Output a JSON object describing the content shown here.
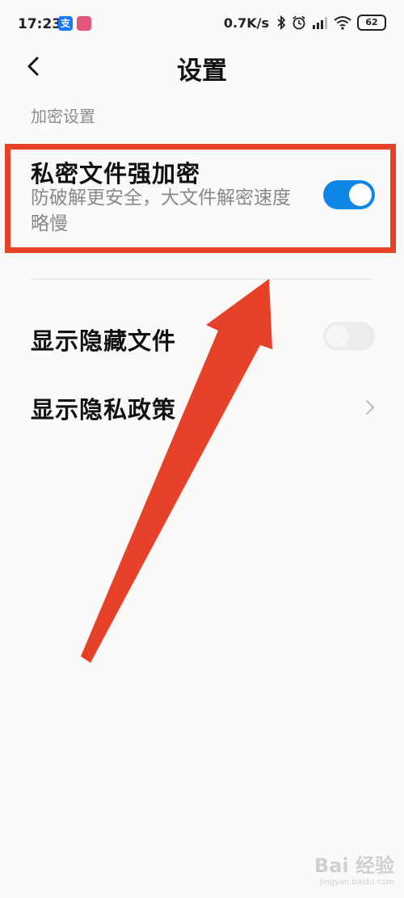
{
  "status_bar": {
    "time": "17:23",
    "network_speed": "0.7K/s",
    "battery_level": "62",
    "app_icon_1_label": "支",
    "icons": [
      "alipay-icon",
      "pink-app-icon",
      "bluetooth-icon",
      "alarm-icon",
      "signal-icon",
      "wifi-icon",
      "battery-icon"
    ]
  },
  "header": {
    "title": "设置",
    "back_icon": "chevron-left-icon"
  },
  "section": {
    "title": "加密设置"
  },
  "settings": {
    "encryption": {
      "title": "私密文件强加密",
      "description": "防破解更安全，大文件解密速度略慢",
      "enabled": true
    },
    "show_hidden": {
      "title": "显示隐藏文件",
      "enabled": false
    },
    "privacy_policy": {
      "title": "显示隐私政策"
    }
  },
  "annotation": {
    "highlight_color": "#e8412a",
    "arrow_color": "#e8412a"
  },
  "colors": {
    "toggle_on": "#0f86e6",
    "toggle_off": "#ececec",
    "background": "#fbfaf8"
  },
  "watermark": {
    "main": "Bai 经验",
    "sub": "jingyan.baidu.com"
  }
}
